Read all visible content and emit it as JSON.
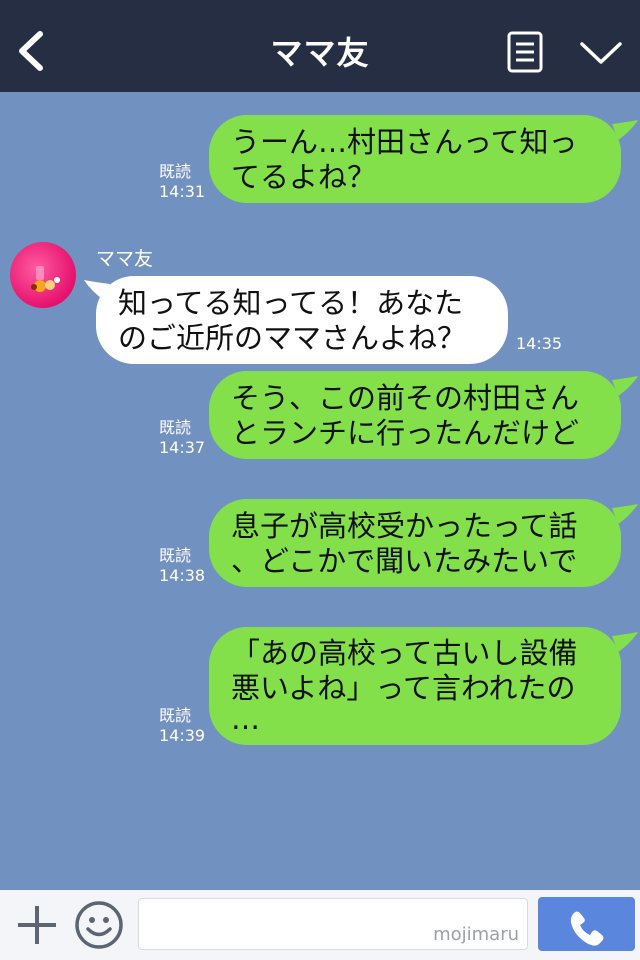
{
  "header": {
    "title": "ママ友",
    "back_icon": "chevron-left-icon",
    "menu_icon": "list-icon",
    "down_icon": "chevron-down-icon"
  },
  "contact": {
    "name": "ママ友",
    "avatar_icon": "profile-avatar"
  },
  "messages": [
    {
      "direction": "out",
      "lines": [
        "うーん…村田さんって知っ",
        "てるよね？"
      ],
      "read": "既読",
      "time": "14:31"
    },
    {
      "direction": "in",
      "lines": [
        "知ってる知ってる！あなた",
        "のご近所のママさんよね？"
      ],
      "time": "14:35"
    },
    {
      "direction": "out",
      "lines": [
        "そう、この前その村田さん",
        "とランチに行ったんだけど"
      ],
      "read": "既読",
      "time": "14:37"
    },
    {
      "direction": "out",
      "lines": [
        "息子が高校受かったって話",
        "、どこかで聞いたみたいで"
      ],
      "read": "既読",
      "time": "14:38"
    },
    {
      "direction": "out",
      "lines": [
        "「あの高校って古いし設備",
        "悪いよね」って言われたの",
        "…"
      ],
      "read": "既読",
      "time": "14:39"
    }
  ],
  "footer": {
    "plus_icon": "plus-icon",
    "emoji_icon": "smiley-icon",
    "input_value": "",
    "watermark": "mojimaru",
    "call_icon": "phone-icon"
  },
  "colors": {
    "header_bg": "#262e44",
    "chat_bg": "#7192c1",
    "out_bubble": "#84e04a",
    "in_bubble": "#ffffff",
    "call_button": "#5a86de"
  }
}
